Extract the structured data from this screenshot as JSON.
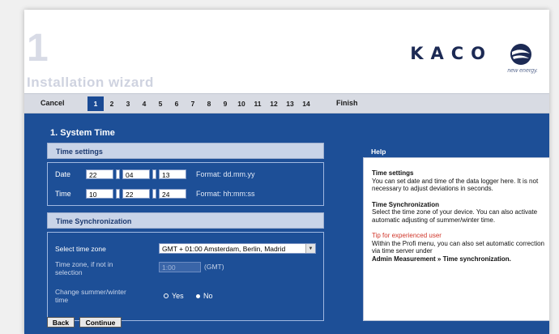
{
  "header": {
    "step_number": "1",
    "wizard_title": "Installation wizard",
    "logo_text": "KACO",
    "logo_tagline": "new energy."
  },
  "nav": {
    "cancel": "Cancel",
    "steps": [
      "1",
      "2",
      "3",
      "4",
      "5",
      "6",
      "7",
      "8",
      "9",
      "10",
      "11",
      "12",
      "13",
      "14"
    ],
    "active_step": "1",
    "finish": "Finish"
  },
  "main": {
    "title": "1. System Time",
    "time_settings": {
      "heading": "Time settings",
      "date_label": "Date",
      "date_day": "22",
      "date_month": "04",
      "date_year": "13",
      "date_format": "Format: dd.mm.yy",
      "time_label": "Time",
      "time_hour": "10",
      "time_minute": "22",
      "time_second": "24",
      "time_format": "Format: hh:mm:ss"
    },
    "time_sync": {
      "heading": "Time Synchronization",
      "zone_label": "Select time zone",
      "zone_value": "GMT + 01:00 Amsterdam, Berlin, Madrid",
      "custom_label": "Time zone, if not in selection",
      "custom_value": "1:00",
      "custom_suffix": "(GMT)",
      "dst_label": "Change summer/winter time",
      "dst_yes": "Yes",
      "dst_no": "No",
      "dst_selected": "No"
    },
    "buttons": {
      "back": "Back",
      "continue": "Continue"
    }
  },
  "help": {
    "tab": "Help",
    "s1_title": "Time settings",
    "s1_text": "You can set date and time of the data logger here. It is not necessary to adjust deviations in seconds.",
    "s2_title": "Time Synchronization",
    "s2_text": "Select the time zone of your device. You can also activate automatic adjusting of summer/winter time.",
    "tip_title": "Tip for experienced user",
    "tip_text": "Within the Profi menu, you can also set automatic correction via time server under",
    "tip_path": "Admin Measurement » Time synchronization."
  },
  "colors": {
    "primary": "#1d4f97",
    "accent": "#d0362a",
    "navbar": "#d8dbe3"
  }
}
